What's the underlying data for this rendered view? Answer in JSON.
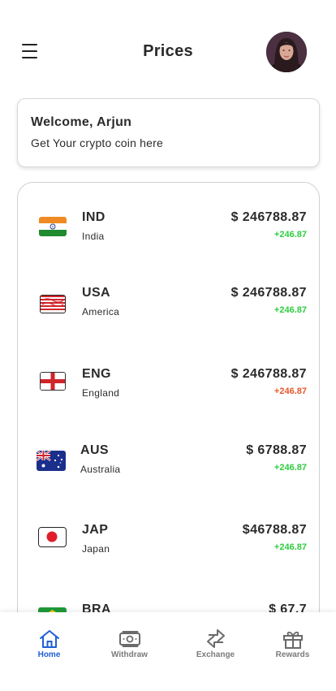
{
  "header": {
    "title": "Prices",
    "menu_icon": "hamburger-menu-icon",
    "avatar": "user-avatar"
  },
  "welcome": {
    "title": "Welcome, Arjun",
    "subtitle": "Get Your crypto coin here"
  },
  "prices": [
    {
      "code": "IND",
      "country": "India",
      "price": "$ 246788.87",
      "change": "+246.87",
      "trend": "up",
      "flag": "india-flag"
    },
    {
      "code": "USA",
      "country": "America",
      "price": "$ 246788.87",
      "change": "+246.87",
      "trend": "up",
      "flag": "usa-flag"
    },
    {
      "code": "ENG",
      "country": "England",
      "price": "$ 246788.87",
      "change": "+246.87",
      "trend": "down",
      "flag": "england-flag"
    },
    {
      "code": "AUS",
      "country": "Australia",
      "price": "$ 6788.87",
      "change": "+246.87",
      "trend": "up",
      "flag": "australia-flag"
    },
    {
      "code": "JAP",
      "country": "Japan",
      "price": "$46788.87",
      "change": "+246.87",
      "trend": "up",
      "flag": "japan-flag"
    },
    {
      "code": "BRA",
      "country": "",
      "price": "$ 67.7",
      "change": "",
      "trend": "up",
      "flag": "brazil-flag"
    }
  ],
  "colors": {
    "up": "#2ecc40",
    "down": "#e8562a",
    "active_nav": "#1f5fd6",
    "inactive_nav": "#7a7a7a"
  },
  "nav": [
    {
      "label": "Home",
      "icon": "home-icon",
      "active": true
    },
    {
      "label": "Withdraw",
      "icon": "cash-icon",
      "active": false
    },
    {
      "label": "Exchange",
      "icon": "exchange-arrows-icon",
      "active": false
    },
    {
      "label": "Rewards",
      "icon": "gift-icon",
      "active": false
    }
  ]
}
